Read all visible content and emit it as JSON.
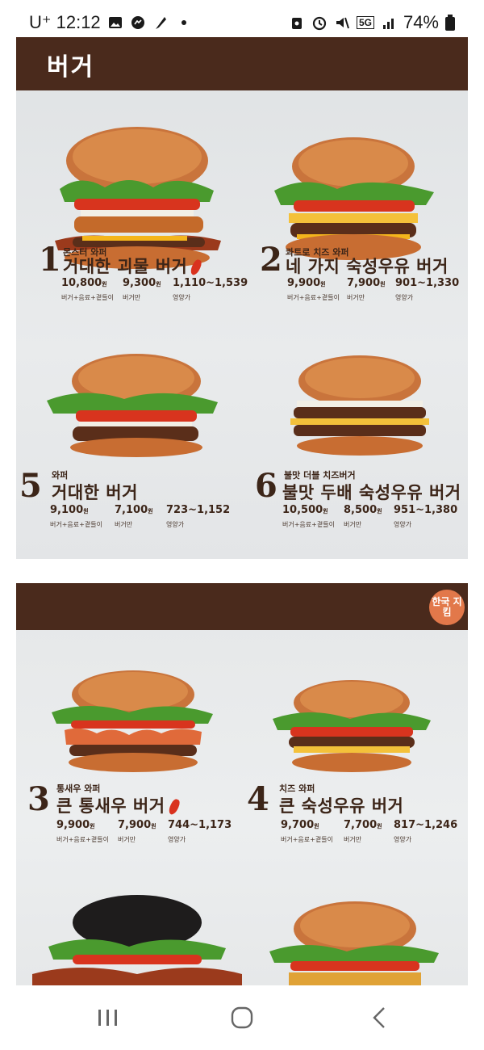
{
  "status_bar": {
    "carrier_time": "U⁺ 12:12",
    "network": "5G",
    "battery": "74%"
  },
  "menu_board_1": {
    "header": "버거",
    "items": [
      {
        "num": "1",
        "sub": "몬스터 와퍼",
        "name": "거대한 괴물 버거",
        "spicy": true,
        "combo_price": "10,800",
        "burger_price": "9,300",
        "kcal": "1,110~1,539"
      },
      {
        "num": "2",
        "sub": "콰트로 치즈 와퍼",
        "name": "네 가지 숙성우유 버거",
        "spicy": false,
        "combo_price": "9,900",
        "burger_price": "7,900",
        "kcal": "901~1,330"
      },
      {
        "num": "5",
        "sub": "와퍼",
        "name": "거대한 버거",
        "spicy": false,
        "combo_price": "9,100",
        "burger_price": "7,100",
        "kcal": "723~1,152"
      },
      {
        "num": "6",
        "sub": "불맛 더블 치즈버거",
        "name": "불맛 두배 숙성우유 버거",
        "spicy": false,
        "combo_price": "10,500",
        "burger_price": "8,500",
        "kcal": "951~1,380"
      }
    ]
  },
  "menu_board_2": {
    "badge": "한국 지킴",
    "items": [
      {
        "num": "3",
        "sub": "통새우 와퍼",
        "name": "큰 통새우 버거",
        "spicy": true,
        "combo_price": "9,900",
        "burger_price": "7,900",
        "kcal": "744~1,173"
      },
      {
        "num": "4",
        "sub": "치즈 와퍼",
        "name": "큰 숙성우유 버거",
        "spicy": false,
        "combo_price": "9,700",
        "burger_price": "7,700",
        "kcal": "817~1,246"
      }
    ]
  },
  "labels": {
    "combo": "버거+음료+곁들이",
    "burger_only": "버거만",
    "nutrition": "영양가",
    "won": "원"
  }
}
